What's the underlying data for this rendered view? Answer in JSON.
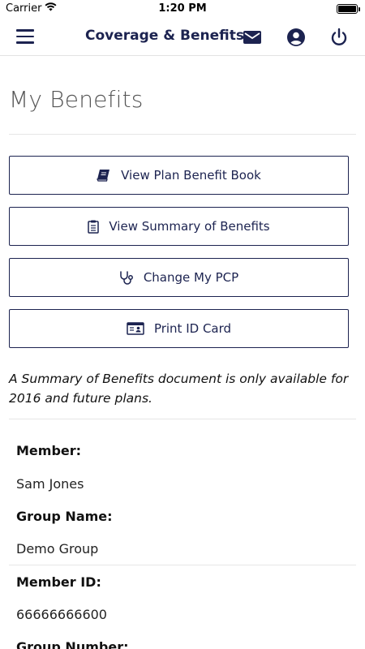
{
  "status_bar": {
    "carrier": "Carrier",
    "time": "1:20 PM",
    "wifi_icon": "wifi-icon",
    "battery_icon": "battery-icon"
  },
  "nav": {
    "title": "Coverage & Benefits",
    "menu_icon": "hamburger-menu-icon",
    "mail_icon": "mail-icon",
    "account_icon": "account-circle-icon",
    "power_icon": "power-icon"
  },
  "page": {
    "title": "My Benefits"
  },
  "actions": [
    {
      "label": "View Plan Benefit Book",
      "icon": "book-icon"
    },
    {
      "label": "View Summary of Benefits",
      "icon": "clipboard-icon"
    },
    {
      "label": "Change My PCP",
      "icon": "stethoscope-icon"
    },
    {
      "label": "Print ID Card",
      "icon": "id-card-icon"
    }
  ],
  "note": "A Summary of Benefits document is only available for 2016 and future plans.",
  "member_info": {
    "member_label": "Member:",
    "member_value": "Sam Jones",
    "group_name_label": "Group Name:",
    "group_name_value": "Demo Group",
    "member_id_label": "Member ID:",
    "member_id_value": "66666666600",
    "group_number_label": "Group Number:"
  },
  "colors": {
    "brand": "#1c2350",
    "divider": "#e6e6e6"
  }
}
